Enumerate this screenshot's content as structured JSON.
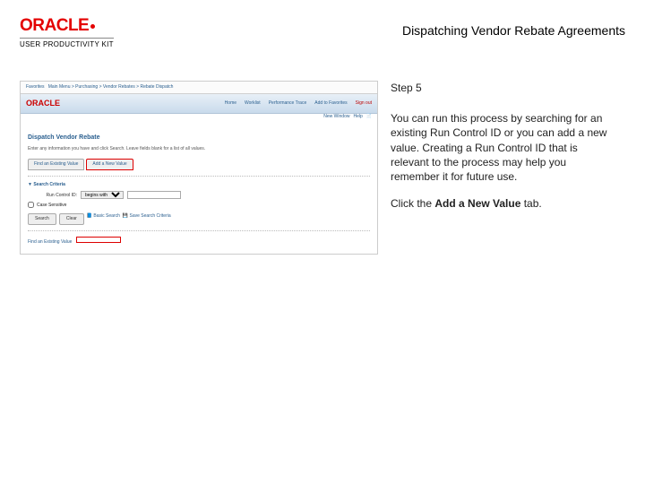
{
  "header": {
    "logo_text": "ORACLE",
    "logo_sub": "USER PRODUCTIVITY KIT",
    "title": "Dispatching Vendor Rebate Agreements"
  },
  "instructions": {
    "step_label": "Step 5",
    "body": "You can run this process by searching for an existing Run Control ID or you can add a new value. Creating a Run Control ID that is relevant to the process may help you remember it for future use.",
    "click_prefix": "Click the ",
    "click_target": "Add a New Value",
    "click_suffix": " tab."
  },
  "app": {
    "breadcrumb_items": [
      "Favorites",
      "Main Menu",
      "Purchasing",
      "Vendor Rebates",
      "Rebate Dispatch"
    ],
    "brand": "ORACLE",
    "nav": [
      "Home",
      "Worklist",
      "Performance Trace",
      "Add to Favorites"
    ],
    "signout": "Sign out",
    "window_footer": [
      "New Window",
      "Help"
    ],
    "page_title": "Dispatch Vendor Rebate",
    "page_desc": "Enter any information you have and click Search. Leave fields blank for a list of all values.",
    "tabs": {
      "find": "Find an Existing Value",
      "add": "Add a New Value"
    },
    "search_criteria": "Search Criteria",
    "run_control_label": "Run Control ID:",
    "begins_with": "begins with",
    "case_sensitive": "Case Sensitive",
    "buttons": {
      "search": "Search",
      "clear": "Clear",
      "basic": "Basic Search",
      "save": "Save Search Criteria"
    },
    "footer_link": "Find an Existing Value"
  }
}
